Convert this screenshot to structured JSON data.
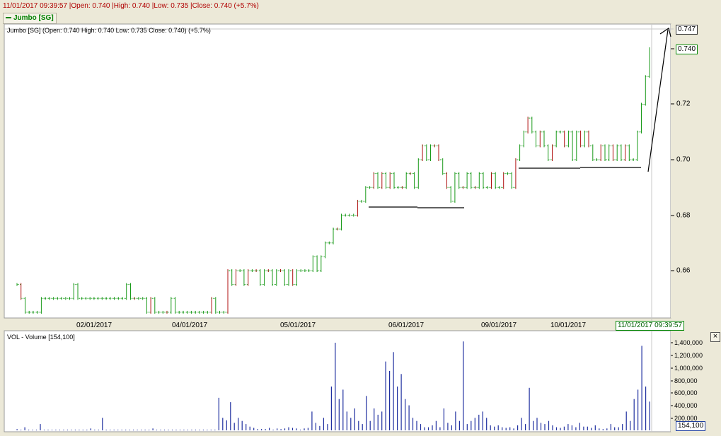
{
  "header": {
    "info": "11/01/2017 09:39:57 |Open: 0.740 |High: 0.740 |Low: 0.735 |Close: 0.740 (+5.7%)",
    "legend": "Jumbo [SG]"
  },
  "price_panel": {
    "label": "Jumbo [SG] (Open: 0.740  High: 0.740  Low: 0.735  Close: 0.740) (+5.7%)",
    "last_price_tag": "0.740",
    "cursor_price_tag": "0.747",
    "cursor_date_tag": "11/01/2017 09:39:57"
  },
  "volume_panel": {
    "label": "VOL - Volume [154,100]",
    "last_volume_tag": "154,100",
    "close_icon": "close-x-icon"
  },
  "colors": {
    "up": "#1a9a1a",
    "down": "#b01010",
    "volume": "#1f2fa0",
    "trendline": "#000000",
    "header_text": "#b00000"
  },
  "chart_data": [
    {
      "type": "line",
      "title": "Jumbo [SG]",
      "x_ticks": [
        "02/01/2017",
        "04/01/2017",
        "05/01/2017",
        "06/01/2017",
        "09/01/2017",
        "10/01/2017"
      ],
      "y_ticks": [
        "0.740",
        "0.72",
        "0.70",
        "0.68",
        "0.66"
      ],
      "ylim": [
        0.645,
        0.749
      ],
      "series": [
        {
          "values": [
            0.655,
            0.65,
            0.645,
            0.645,
            0.645,
            0.645,
            0.65,
            0.65,
            0.65,
            0.65,
            0.65,
            0.65,
            0.65,
            0.65,
            0.655,
            0.65,
            0.65,
            0.65,
            0.65,
            0.65,
            0.65,
            0.65,
            0.65,
            0.65,
            0.65,
            0.65,
            0.65,
            0.655,
            0.65,
            0.65,
            0.65,
            0.65,
            0.645,
            0.65,
            0.645,
            0.645,
            0.645,
            0.645,
            0.65,
            0.645,
            0.645,
            0.645,
            0.645,
            0.645,
            0.645,
            0.645,
            0.645,
            0.645,
            0.65,
            0.645,
            0.645,
            0.645,
            0.66,
            0.655,
            0.66,
            0.66,
            0.655,
            0.66,
            0.66,
            0.66,
            0.655,
            0.66,
            0.66,
            0.655,
            0.66,
            0.66,
            0.655,
            0.66,
            0.655,
            0.66,
            0.66,
            0.66,
            0.66,
            0.665,
            0.66,
            0.665,
            0.67,
            0.67,
            0.675,
            0.675,
            0.68,
            0.68,
            0.68,
            0.68,
            0.685,
            0.685,
            0.69,
            0.69,
            0.695,
            0.69,
            0.695,
            0.69,
            0.695,
            0.69,
            0.69,
            0.69,
            0.695,
            0.695,
            0.69,
            0.7,
            0.705,
            0.7,
            0.705,
            0.705,
            0.7,
            0.695,
            0.69,
            0.685,
            0.695,
            0.69,
            0.69,
            0.695,
            0.69,
            0.69,
            0.695,
            0.69,
            0.69,
            0.695,
            0.69,
            0.69,
            0.695,
            0.695,
            0.69,
            0.7,
            0.705,
            0.71,
            0.715,
            0.71,
            0.705,
            0.71,
            0.705,
            0.7,
            0.705,
            0.71,
            0.71,
            0.705,
            0.71,
            0.7,
            0.71,
            0.705,
            0.71,
            0.705,
            0.7,
            0.7,
            0.705,
            0.7,
            0.705,
            0.7,
            0.705,
            0.7,
            0.705,
            0.7,
            0.7,
            0.71,
            0.72,
            0.73,
            0.74
          ],
          "updown": [
            1,
            0,
            1,
            1,
            1,
            1,
            1,
            1,
            1,
            1,
            1,
            1,
            1,
            1,
            1,
            1,
            1,
            1,
            1,
            1,
            1,
            1,
            1,
            1,
            1,
            1,
            1,
            1,
            1,
            0,
            1,
            1,
            1,
            0,
            1,
            1,
            1,
            0,
            1,
            1,
            1,
            1,
            1,
            1,
            1,
            1,
            1,
            1,
            0,
            1,
            1,
            1,
            0,
            1,
            0,
            1,
            1,
            0,
            1,
            0,
            1,
            1,
            0,
            1,
            1,
            0,
            1,
            1,
            0,
            1,
            1,
            1,
            1,
            1,
            1,
            1,
            1,
            1,
            1,
            0,
            1,
            1,
            1,
            1,
            0,
            1,
            1,
            1,
            0,
            1,
            0,
            1,
            0,
            1,
            1,
            0,
            1,
            0,
            1,
            1,
            0,
            1,
            1,
            0,
            0,
            1,
            0,
            1,
            1,
            1,
            0,
            1,
            1,
            0,
            1,
            1,
            1,
            0,
            1,
            1,
            0,
            1,
            1,
            0,
            1,
            1,
            0,
            1,
            1,
            0,
            1,
            1,
            0,
            1,
            1,
            0,
            1,
            1,
            1,
            0,
            1,
            0,
            1,
            1,
            0,
            1,
            1,
            0,
            1,
            1,
            0,
            1,
            1,
            1,
            1,
            1,
            1
          ]
        }
      ]
    },
    {
      "type": "bar",
      "title": "VOL - Volume",
      "y_ticks": [
        "1,400,000",
        "1,200,000",
        "1,000,000",
        "800,000",
        "600,000",
        "400,000",
        "200,000"
      ],
      "ylim": [
        0,
        1450000
      ],
      "series": [
        {
          "name": "VOL - Volume",
          "values": [
            20000,
            0,
            50000,
            10000,
            0,
            0,
            100000,
            0,
            0,
            0,
            0,
            0,
            0,
            0,
            0,
            0,
            0,
            0,
            0,
            30000,
            0,
            0,
            200000,
            0,
            0,
            0,
            0,
            0,
            0,
            0,
            0,
            0,
            0,
            0,
            0,
            30000,
            0,
            0,
            0,
            0,
            0,
            0,
            0,
            0,
            0,
            0,
            0,
            0,
            0,
            0,
            0,
            0,
            520000,
            200000,
            160000,
            450000,
            120000,
            200000,
            150000,
            100000,
            60000,
            40000,
            20000,
            20000,
            20000,
            40000,
            0,
            30000,
            20000,
            30000,
            50000,
            40000,
            30000,
            0,
            30000,
            40000,
            300000,
            120000,
            70000,
            200000,
            100000,
            700000,
            1400000,
            500000,
            650000,
            300000,
            200000,
            350000,
            150000,
            100000,
            550000,
            150000,
            350000,
            250000,
            300000,
            1100000,
            950000,
            1250000,
            700000,
            900000,
            500000,
            400000,
            200000,
            150000,
            100000,
            50000,
            50000,
            80000,
            150000,
            50000,
            350000,
            120000,
            80000,
            300000,
            150000,
            1420000,
            100000,
            150000,
            200000,
            250000,
            300000,
            200000,
            80000,
            60000,
            80000,
            50000,
            40000,
            50000,
            30000,
            80000,
            200000,
            100000,
            680000,
            150000,
            200000,
            120000,
            100000,
            150000,
            80000,
            50000,
            40000,
            60000,
            100000,
            80000,
            50000,
            120000,
            60000,
            60000,
            40000,
            80000,
            30000,
            20000,
            30000,
            100000,
            50000,
            50000,
            100000,
            300000,
            150000,
            500000,
            650000,
            1350000,
            700000,
            460000
          ]
        }
      ]
    }
  ]
}
